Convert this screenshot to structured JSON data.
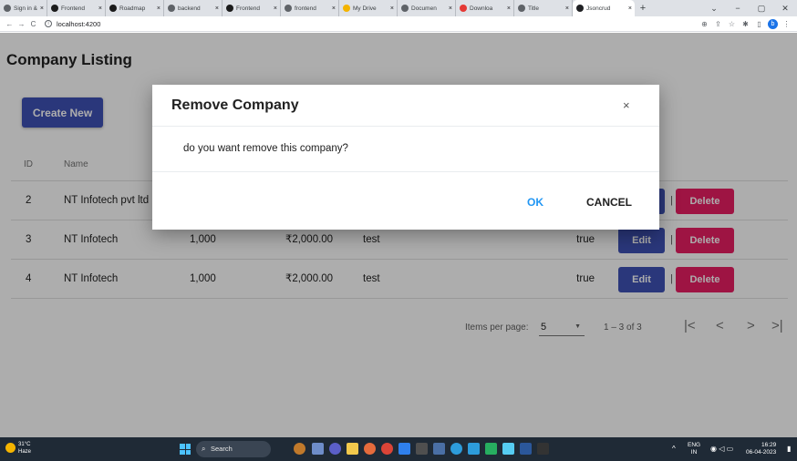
{
  "browser": {
    "tabs": [
      {
        "label": "Sign in &",
        "favicon": "globe-icon",
        "active": false
      },
      {
        "label": "Frontend",
        "favicon": "gfg-icon",
        "active": false
      },
      {
        "label": "Roadmap",
        "favicon": "gfg-icon",
        "active": false
      },
      {
        "label": "backend",
        "favicon": "globe-icon",
        "active": false
      },
      {
        "label": "Frontend",
        "favicon": "gfg-icon",
        "active": false
      },
      {
        "label": "frontend",
        "favicon": "globe-icon",
        "active": false
      },
      {
        "label": "My Drive",
        "favicon": "drive-icon",
        "active": false
      },
      {
        "label": "Documen",
        "favicon": "globe-icon",
        "active": false
      },
      {
        "label": "Downloa",
        "favicon": "heart-icon",
        "active": false
      },
      {
        "label": "Title",
        "favicon": "globe-icon",
        "active": false
      },
      {
        "label": "Jsoncrud",
        "favicon": "angular-icon",
        "active": true
      }
    ],
    "url": "localhost:4200",
    "profile_initial": "b"
  },
  "page": {
    "title": "Company Listing",
    "create_button": "Create New",
    "columns": {
      "id": "ID",
      "name": "Name"
    },
    "rows": [
      {
        "id": "2",
        "name": "NT Infotech pvt ltd",
        "count": "",
        "amount": "",
        "note": "",
        "flag": "",
        "edit": "Edit",
        "delete": "Delete"
      },
      {
        "id": "3",
        "name": "NT Infotech",
        "count": "1,000",
        "amount": "₹2,000.00",
        "note": "test",
        "flag": "true",
        "edit": "Edit",
        "delete": "Delete"
      },
      {
        "id": "4",
        "name": "NT Infotech",
        "count": "1,000",
        "amount": "₹2,000.00",
        "note": "test",
        "flag": "true",
        "edit": "Edit",
        "delete": "Delete"
      }
    ],
    "separator": "|",
    "paginator": {
      "items_per_page_label": "Items per page:",
      "page_size": "5",
      "range": "1 – 3 of 3"
    }
  },
  "modal": {
    "title": "Remove Company",
    "close": "×",
    "message": "do you want remove this company?",
    "ok": "OK",
    "cancel": "CANCEL"
  },
  "taskbar": {
    "temperature": "31°C",
    "weather": "Haze",
    "search": "Search",
    "language": "ENG",
    "region": "IN",
    "time": "16:29",
    "date": "06-04-2023"
  },
  "colors": {
    "primary": "#3f51b5",
    "danger": "#e91e63",
    "ok": "#2196f3"
  }
}
